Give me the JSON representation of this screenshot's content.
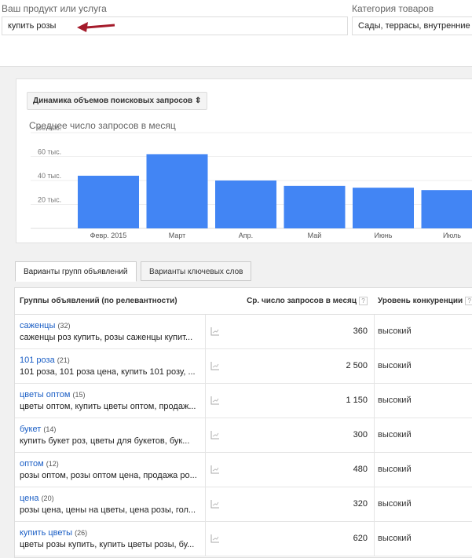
{
  "product": {
    "label": "Ваш продукт или услуга",
    "value": "купить розы"
  },
  "category": {
    "label": "Категория товаров",
    "value": "Сады, террасы, внутренние д"
  },
  "chart_select": "Динамика объемов поисковых запросов",
  "chart_data": {
    "type": "bar",
    "title": "Среднее число запросов в месяц",
    "categories": [
      "Февр. 2015",
      "Март",
      "Апр.",
      "Май",
      "Июнь",
      "Июль"
    ],
    "values": [
      44000,
      62000,
      40000,
      35500,
      34000,
      32000
    ],
    "yticks": [
      "20 тыс.",
      "40 тыс.",
      "60 тыс.",
      "80 тыс."
    ],
    "ytick_values": [
      20000,
      40000,
      60000,
      80000
    ],
    "ylim": [
      0,
      80000
    ],
    "color": "#4285f4"
  },
  "tabs": [
    "Варианты групп объявлений",
    "Варианты ключевых слов"
  ],
  "table": {
    "headers": {
      "group": "Группы объявлений (по релевантности)",
      "avg": "Ср. число запросов в месяц",
      "comp": "Уровень конкуренции",
      "help": "?"
    },
    "rows": [
      {
        "name": "саженцы",
        "count": "(32)",
        "keywords": "саженцы роз купить, розы саженцы купит...",
        "avg": "360",
        "comp": "высокий"
      },
      {
        "name": "101 роза",
        "count": "(21)",
        "keywords": "101 роза, 101 роза цена, купить 101 розу, ...",
        "avg": "2 500",
        "comp": "высокий"
      },
      {
        "name": "цветы оптом",
        "count": "(15)",
        "keywords": "цветы оптом, купить цветы оптом, продаж...",
        "avg": "1 150",
        "comp": "высокий"
      },
      {
        "name": "букет",
        "count": "(14)",
        "keywords": "купить букет роз, цветы для букетов, бук...",
        "avg": "300",
        "comp": "высокий"
      },
      {
        "name": "оптом",
        "count": "(12)",
        "keywords": "розы оптом, розы оптом цена, продажа ро...",
        "avg": "480",
        "comp": "высокий"
      },
      {
        "name": "цена",
        "count": "(20)",
        "keywords": "розы цена, цены на цветы, цена розы, гол...",
        "avg": "320",
        "comp": "высокий"
      },
      {
        "name": "купить цветы",
        "count": "(26)",
        "keywords": "цветы розы купить, купить цветы розы, бу...",
        "avg": "620",
        "comp": "высокий"
      }
    ]
  }
}
